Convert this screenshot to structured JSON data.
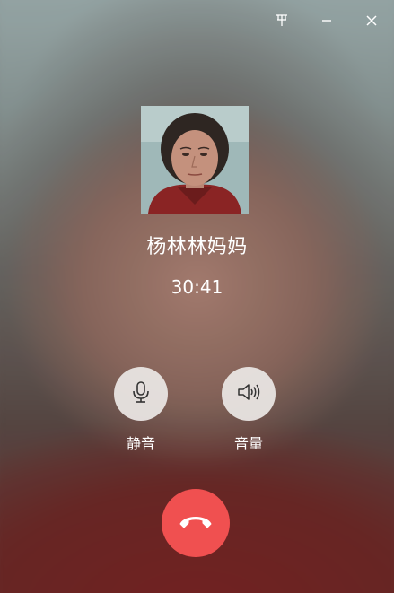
{
  "window": {
    "controls": [
      {
        "name": "pin",
        "icon": "pin-icon"
      },
      {
        "name": "minimize",
        "icon": "minimize-icon"
      },
      {
        "name": "close",
        "icon": "close-icon"
      }
    ]
  },
  "caller": {
    "name": "杨林林妈妈",
    "duration": "30:41",
    "avatar_icon": "contact-photo"
  },
  "actions": {
    "mute": {
      "label": "静音",
      "icon": "microphone-icon"
    },
    "volume": {
      "label": "音量",
      "icon": "speaker-icon"
    },
    "hangup": {
      "icon": "hang-up-phone-icon",
      "color": "#f05050"
    }
  },
  "colors": {
    "hangup_red": "#f05050",
    "text": "#ffffff",
    "action_circle": "#ebe8e6"
  }
}
